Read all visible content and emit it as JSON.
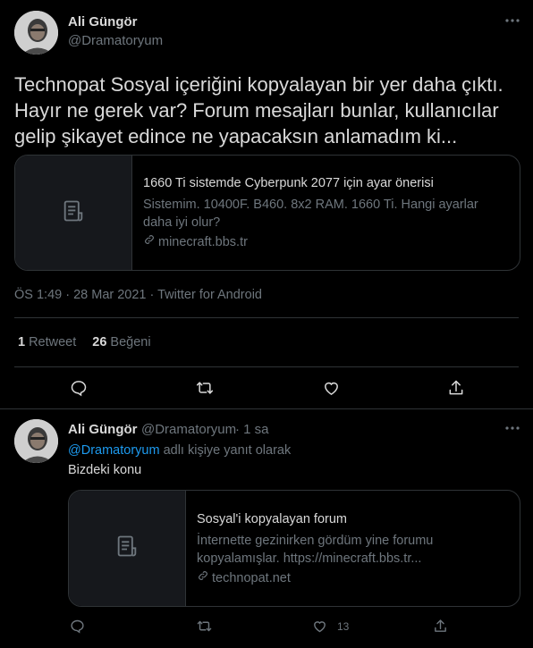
{
  "tweet": {
    "author_name": "Ali Güngör",
    "author_handle": "@Dramatoryum",
    "text": "Technopat Sosyal içeriğini kopyalayan bir yer daha çıktı. Hayır ne gerek var? Forum mesajları bunlar, kullanıcılar gelip şikayet edince ne yapacaksın anlamadım ki...",
    "card": {
      "title": "1660 Ti sistemde Cyberpunk 2077 için ayar önerisi",
      "description": "Sistemim. 10400F. B460. 8x2 RAM. 1660 Ti. Hangi ayarlar daha iyi olur?",
      "domain": "minecraft.bbs.tr"
    },
    "meta": "ÖS 1:49 · 28 Mar 2021 · Twitter for Android",
    "retweets_count": "1",
    "retweets_label": "Retweet",
    "likes_count": "26",
    "likes_label": "Beğeni"
  },
  "reply": {
    "author_name": "Ali Güngör",
    "author_handle": "@Dramatoryum",
    "time": "· 1 sa",
    "replying_mention": "@Dramatoryum",
    "replying_suffix": "adlı kişiye yanıt olarak",
    "text": "Bizdeki konu",
    "card": {
      "title": "Sosyal'i kopyalayan forum",
      "description": "İnternette gezinirken gördüm yine forumu kopyalamışlar. https://minecraft.bbs.tr...",
      "domain": "technopat.net"
    },
    "likes_count": "13"
  },
  "icons": {
    "more": "more-icon",
    "reply": "reply-icon",
    "retweet": "retweet-icon",
    "like": "heart-icon",
    "share": "share-icon",
    "document": "document-icon",
    "link": "link-icon"
  },
  "colors": {
    "background": "#000000",
    "text": "#d9d9d9",
    "muted": "#6e767d",
    "border": "#2f3336",
    "link": "#1d9bf0"
  }
}
